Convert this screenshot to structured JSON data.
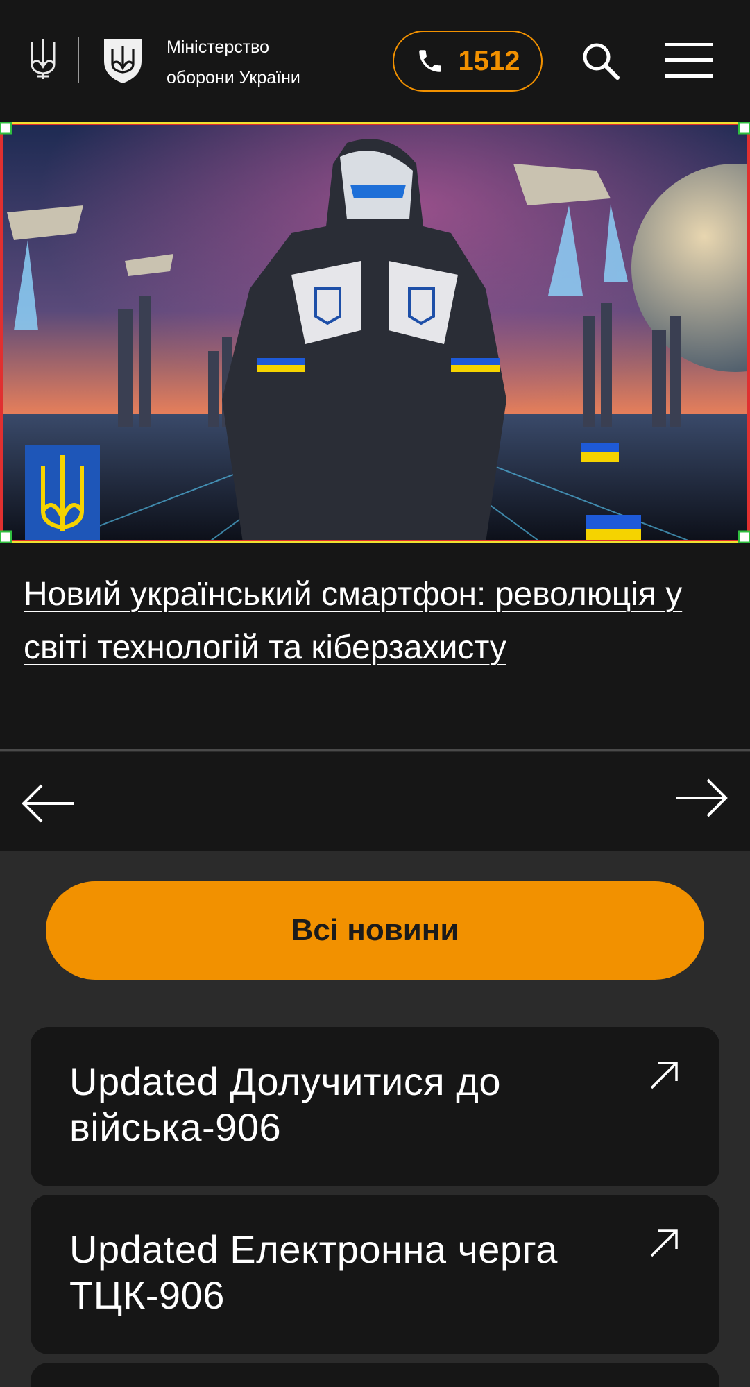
{
  "header": {
    "brand_line1": "Міністерство",
    "brand_line2": "оборони України",
    "phone": "1512",
    "icons": [
      "trident-icon",
      "shield-logo-icon",
      "phone-icon",
      "search-icon",
      "menu-icon"
    ]
  },
  "slider": {
    "headline": "Новий український смартфон: революція у світі технологій та кіберзахисту"
  },
  "all_news_label": "Всі новини",
  "cards": [
    {
      "title": "Updated Долучитися до війська-906"
    },
    {
      "title": "Updated Електронна черга ТЦК-906"
    }
  ],
  "colors": {
    "accent": "#f29100",
    "header_bg": "#161616",
    "page_bg": "#2b2b2b",
    "card_bg": "#161616"
  }
}
